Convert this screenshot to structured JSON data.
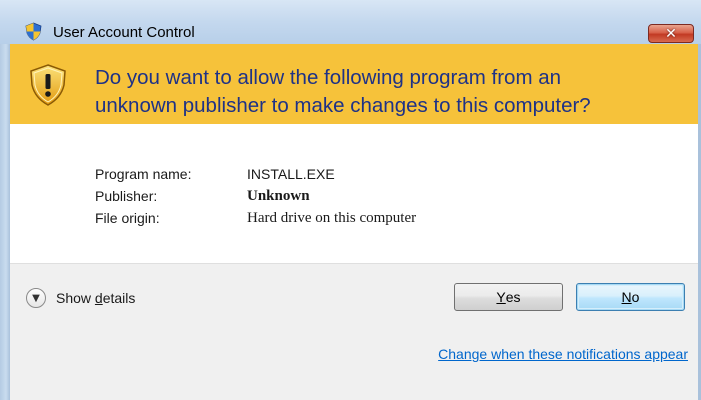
{
  "window": {
    "title": "User Account Control",
    "close_label": "✕",
    "colors": {
      "banner": "#f6c23a",
      "banner_text": "#1e3287",
      "link": "#0066cc",
      "frame": "#b9d1ea"
    }
  },
  "banner": {
    "icon": "shield-warning-icon",
    "line1": "Do you want to allow the following program from an",
    "line2": "unknown publisher to make changes to this computer?"
  },
  "details": [
    {
      "label": "Program name:",
      "value": "INSTALL.EXE"
    },
    {
      "label": "Publisher:",
      "value": "Unknown"
    },
    {
      "label": "File origin:",
      "value": "Hard drive on this computer"
    }
  ],
  "footer": {
    "show_details_pre": "Show ",
    "show_details_key": "d",
    "show_details_post": "etails",
    "yes_key": "Y",
    "yes_rest": "es",
    "no_key": "N",
    "no_rest": "o",
    "notifications_link": "Change when these notifications appear"
  }
}
